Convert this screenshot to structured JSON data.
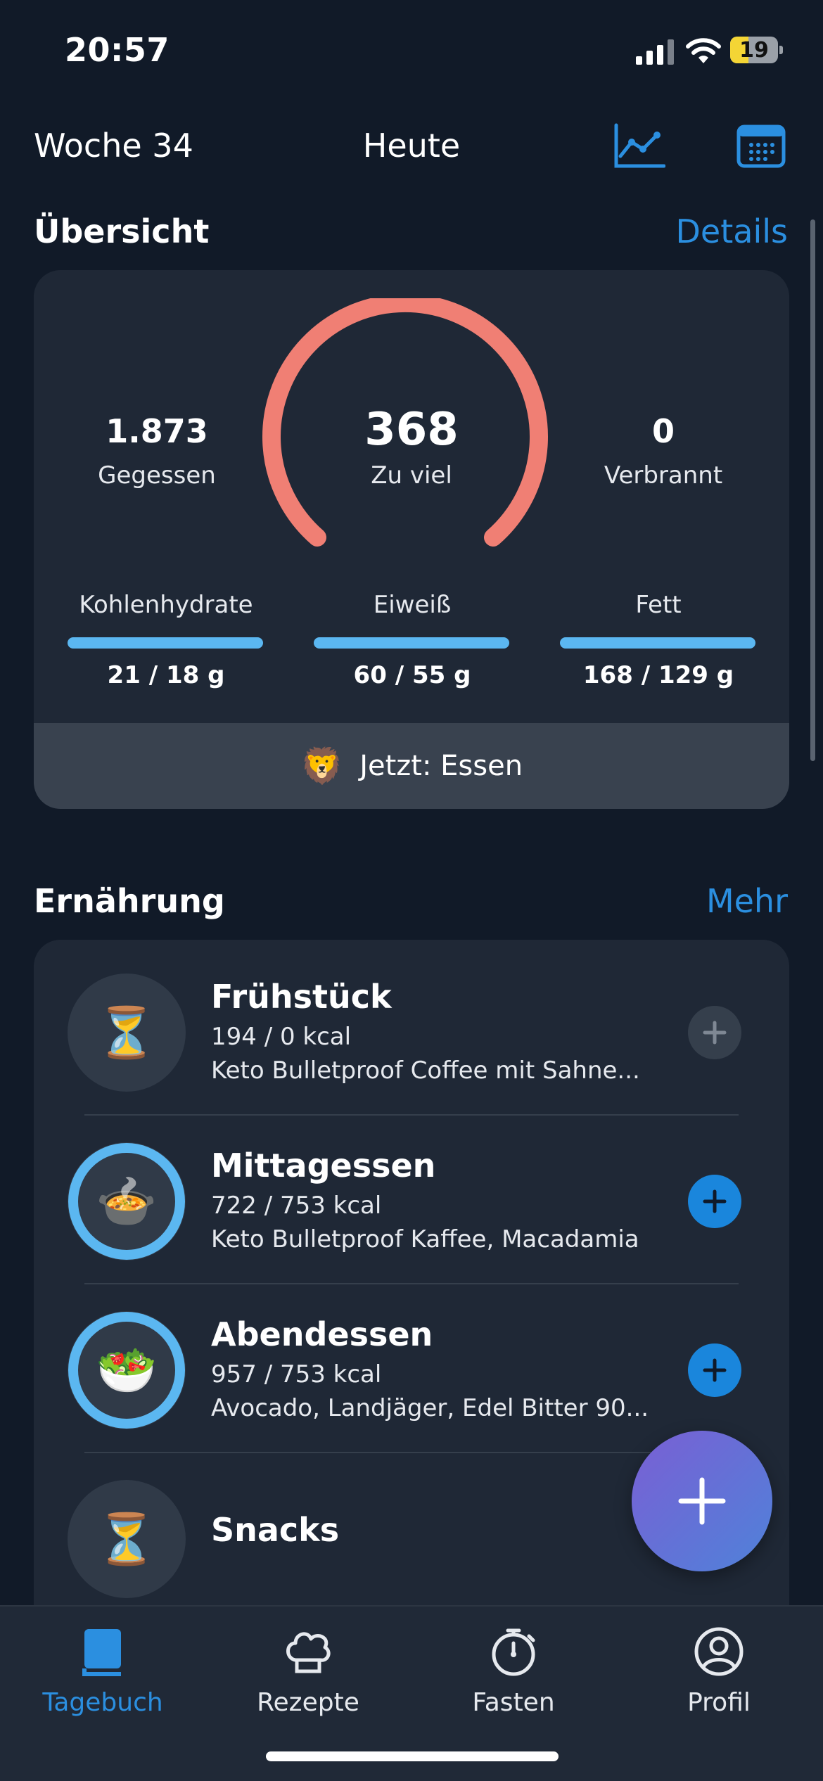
{
  "status_bar": {
    "time": "20:57",
    "battery": "19"
  },
  "header": {
    "week": "Woche 34",
    "title": "Heute"
  },
  "overview": {
    "title": "Übersicht",
    "link": "Details",
    "eaten": {
      "value": "1.873",
      "label": "Gegessen"
    },
    "center": {
      "value": "368",
      "label": "Zu viel"
    },
    "burned": {
      "value": "0",
      "label": "Verbrannt"
    },
    "macros": [
      {
        "label": "Kohlenhydrate",
        "value": "21 / 18 g"
      },
      {
        "label": "Eiweiß",
        "value": "60 / 55 g"
      },
      {
        "label": "Fett",
        "value": "168 / 129 g"
      }
    ],
    "now_emoji": "🦁",
    "now_text": "Jetzt: Essen",
    "colors": {
      "gauge": "#f07f74",
      "macro_bar": "#5bb7f1"
    }
  },
  "nutrition": {
    "title": "Ernährung",
    "link": "Mehr",
    "meals": [
      {
        "name": "Frühstück",
        "kcal": "194 / 0 kcal",
        "items": "Keto Bulletproof Coffee mit Sahne...",
        "emoji": "⏳"
      },
      {
        "name": "Mittagessen",
        "kcal": "722 / 753 kcal",
        "items": "Keto Bulletproof Kaffee, Macadamia",
        "emoji": "🍲"
      },
      {
        "name": "Abendessen",
        "kcal": "957 / 753 kcal",
        "items": "Avocado, Landjäger, Edel Bitter 90...",
        "emoji": "🥗"
      },
      {
        "name": "Snacks",
        "emoji": "⏳"
      }
    ]
  },
  "tabs": [
    {
      "label": "Tagebuch",
      "icon": "book-icon",
      "active": true
    },
    {
      "label": "Rezepte",
      "icon": "chef-hat-icon"
    },
    {
      "label": "Fasten",
      "icon": "stopwatch-icon"
    },
    {
      "label": "Profil",
      "icon": "profile-icon"
    }
  ],
  "accent": "#2b8fe0"
}
